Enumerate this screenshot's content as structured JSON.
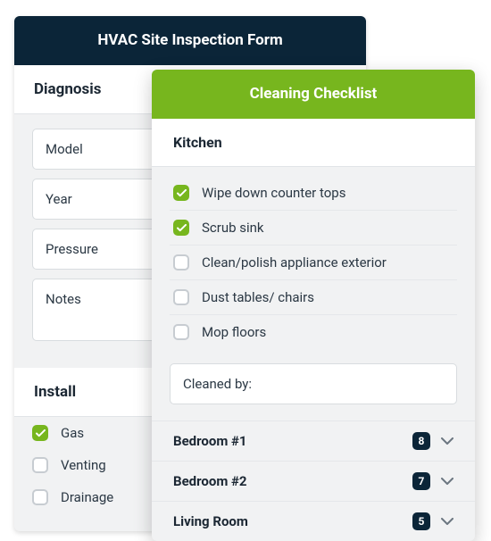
{
  "hvac": {
    "title": "HVAC Site Inspection Form",
    "diagnosis_label": "Diagnosis",
    "fields": {
      "model": "Model",
      "year": "Year",
      "pressure": "Pressure",
      "notes": "Notes"
    },
    "install_label": "Install",
    "install_options": [
      {
        "label": "Gas",
        "checked": true
      },
      {
        "label": "Venting",
        "checked": false
      },
      {
        "label": "Drainage",
        "checked": false
      }
    ]
  },
  "cleaning": {
    "title": "Cleaning Checklist",
    "section": "Kitchen",
    "items": [
      {
        "label": "Wipe down counter tops",
        "checked": true
      },
      {
        "label": "Scrub sink",
        "checked": true
      },
      {
        "label": "Clean/polish appliance exterior",
        "checked": false
      },
      {
        "label": "Dust tables/ chairs",
        "checked": false
      },
      {
        "label": "Mop floors",
        "checked": false
      }
    ],
    "cleaned_by": "Cleaned by:",
    "rooms": [
      {
        "name": "Bedroom #1",
        "count": "8"
      },
      {
        "name": "Bedroom #2",
        "count": "7"
      },
      {
        "name": "Living Room",
        "count": "5"
      }
    ]
  }
}
